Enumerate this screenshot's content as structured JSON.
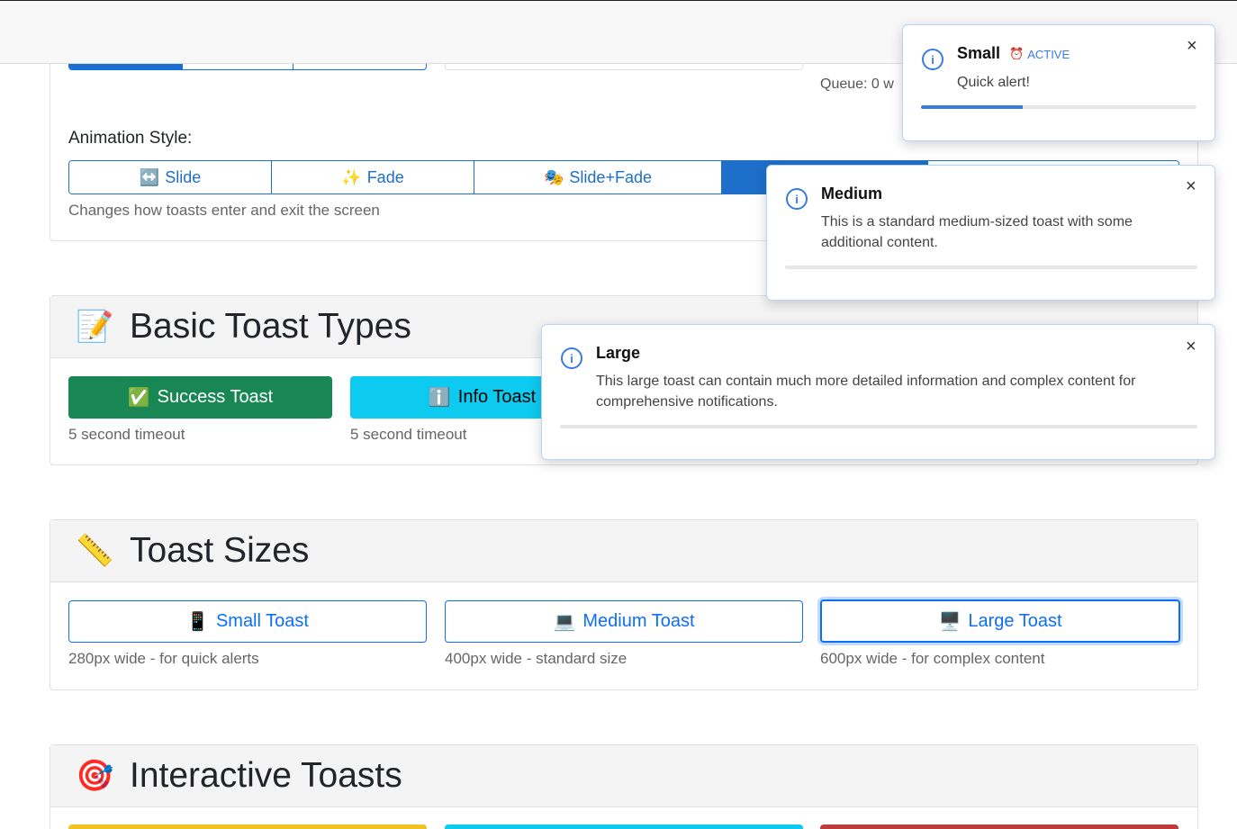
{
  "position_section": {
    "queue_text": "Queue: 0 w",
    "animation_label": "Animation Style:",
    "animation_buttons": [
      {
        "icon": "↔️",
        "label": "Slide"
      },
      {
        "icon": "✨",
        "label": "Fade"
      },
      {
        "icon": "🎭",
        "label": "Slide+Fade"
      },
      {
        "icon": "",
        "label": ""
      },
      {
        "icon": "",
        "label": ""
      }
    ],
    "animation_help": "Changes how toasts enter and exit the screen"
  },
  "basic_section": {
    "emoji": "📝",
    "title": "Basic Toast Types",
    "success": {
      "icon": "✅",
      "label": "Success Toast",
      "help": "5 second timeout"
    },
    "info": {
      "icon": "ℹ️",
      "label": "Info Toast",
      "help": "5 second timeout"
    }
  },
  "sizes_section": {
    "emoji": "📏",
    "title": "Toast Sizes",
    "small": {
      "icon": "📱",
      "label": "Small Toast",
      "help": "280px wide - for quick alerts"
    },
    "medium": {
      "icon": "💻",
      "label": "Medium Toast",
      "help": "400px wide - standard size"
    },
    "large": {
      "icon": "🖥️",
      "label": "Large Toast",
      "help": "600px wide - for complex content"
    }
  },
  "interactive_section": {
    "emoji": "🎯",
    "title": "Interactive Toasts"
  },
  "colors": {
    "primary": "#0d6efd",
    "success": "#198754",
    "info": "#0dcaf0",
    "warning": "#f0c420",
    "danger": "#c0393b"
  },
  "toasts": {
    "small": {
      "title": "Small",
      "badge_icon": "⏰",
      "badge": "ACTIVE",
      "body": "Quick alert!",
      "close": "×",
      "progress": 0.37
    },
    "medium": {
      "title": "Medium",
      "body": "This is a standard medium-sized toast with some additional content.",
      "close": "×",
      "progress": 0
    },
    "large": {
      "title": "Large",
      "body": "This large toast can contain much more detailed information and complex content for comprehensive notifications.",
      "close": "×",
      "progress": 0
    }
  }
}
